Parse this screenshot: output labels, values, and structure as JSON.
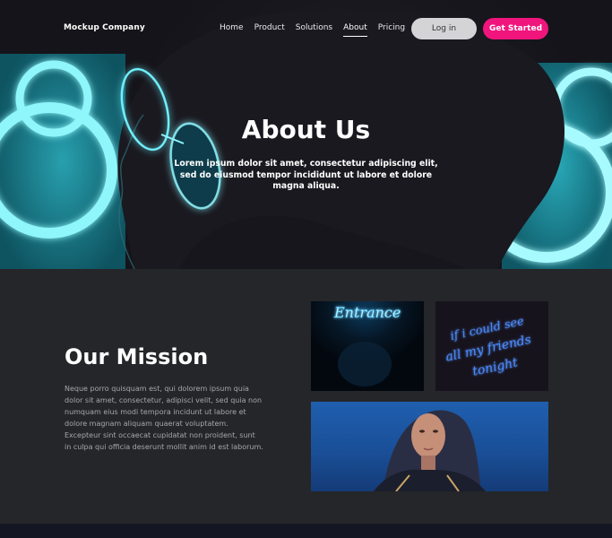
{
  "nav": {
    "brand": "Mockup Company",
    "links": [
      "Home",
      "Product",
      "Solutions",
      "About",
      "Pricing"
    ],
    "active": "About",
    "login": "Log in",
    "cta": "Get Started"
  },
  "hero": {
    "title": "About Us",
    "subtitle": "Lorem ipsum dolor sit amet, consectetur adipiscing elit, sed do eiusmod tempor incididunt ut labore et dolore magna aliqua."
  },
  "mission": {
    "title": "Our Mission",
    "body": "Neque porro quisquam est, qui dolorem ipsum quia dolor sit amet, consectetur, adipisci velit, sed quia non numquam eius modi tempora incidunt ut labore et dolore magnam aliquam quaerat voluptatem. Excepteur sint occaecat cupidatat non proident, sunt in culpa qui officia deserunt mollit anim id est laborum.",
    "images": [
      {
        "sign": "Entrance"
      },
      {
        "sign": [
          "if i could see",
          "all my friends",
          "tonight"
        ]
      },
      {}
    ]
  },
  "colors": {
    "accent": "#f0157d",
    "neon": "#38e6f0",
    "bg": "#25262a"
  }
}
